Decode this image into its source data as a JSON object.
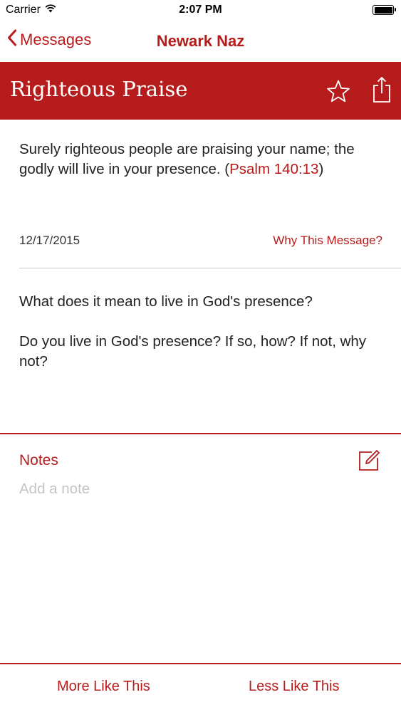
{
  "status_bar": {
    "carrier": "Carrier",
    "time": "2:07 PM"
  },
  "nav": {
    "back_label": "Messages",
    "title": "Newark Naz"
  },
  "header": {
    "title": "Righteous Praise"
  },
  "message": {
    "verse_text": "Surely righteous people are praising your name; the godly will live in your presence. (",
    "verse_ref": "Psalm 140:13",
    "verse_close": ")",
    "date": "12/17/2015",
    "why_link": "Why This Message?",
    "question_1": "What does it mean to live in God's presence?",
    "question_2": "Do you live in God's presence? If so, how? If not, why not?"
  },
  "notes": {
    "label": "Notes",
    "placeholder": "Add a note"
  },
  "actions": {
    "more_label": "More Like This",
    "less_label": "Less Like This"
  },
  "colors": {
    "accent": "#b71c1c",
    "placeholder": "#c4c4c4"
  }
}
